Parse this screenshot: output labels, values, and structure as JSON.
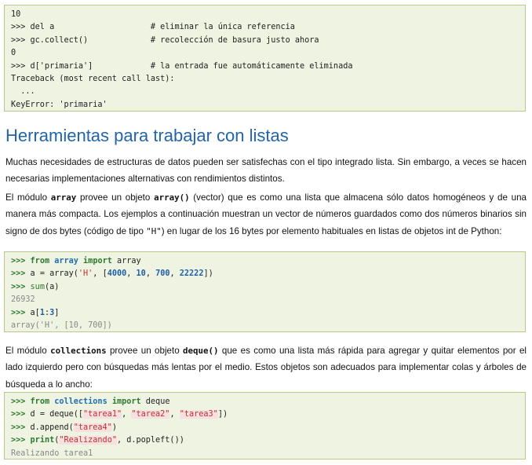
{
  "block1": [
    {
      "parts": [
        {
          "t": "10"
        }
      ]
    },
    {
      "parts": [
        {
          "t": ">>> del a                    # eliminar la única referencia"
        }
      ]
    },
    {
      "parts": [
        {
          "t": ">>> gc.collect()             # recolección de basura justo ahora"
        }
      ]
    },
    {
      "parts": [
        {
          "t": "0"
        }
      ]
    },
    {
      "parts": [
        {
          "t": ">>> d['primaria']            # la entrada fue automáticamente eliminada"
        }
      ]
    },
    {
      "parts": [
        {
          "t": "Traceback (most recent call last):"
        }
      ]
    },
    {
      "parts": [
        {
          "t": "  ..."
        }
      ]
    },
    {
      "parts": [
        {
          "t": "KeyError: 'primaria'"
        }
      ]
    }
  ],
  "heading": "Herramientas para trabajar con listas",
  "para1": "Muchas necesidades de estructuras de datos pueden ser satisfechas con el tipo integrado lista. Sin embargo, a veces se hacen necesarias implementaciones alternativas con rendimientos distintos.",
  "para2": {
    "a": "El módulo ",
    "b": "array",
    "c": " provee un objeto ",
    "d": "array()",
    "e": " (vector) que es como una lista que almacena sólo datos homogéneos y de una manera más compacta. Los ejemplos a continuación muestran un vector de números guardados como dos números binarios sin signo de dos bytes (código de tipo ",
    "f": "\"H\"",
    "g": ") en lugar de los 16 bytes por elemento habituales en listas de objetos int de Python:"
  },
  "block2": [
    {
      "parts": [
        {
          "t": ">>> ",
          "c": "pr"
        },
        {
          "t": "from",
          "c": "kw"
        },
        {
          "t": " "
        },
        {
          "t": "array",
          "c": "mod"
        },
        {
          "t": " "
        },
        {
          "t": "import",
          "c": "kw"
        },
        {
          "t": " array"
        }
      ]
    },
    {
      "parts": [
        {
          "t": ">>> ",
          "c": "pr"
        },
        {
          "t": "a = array("
        },
        {
          "t": "'H'",
          "c": "str"
        },
        {
          "t": ", ["
        },
        {
          "t": "4000",
          "c": "num"
        },
        {
          "t": ", "
        },
        {
          "t": "10",
          "c": "num"
        },
        {
          "t": ", "
        },
        {
          "t": "700",
          "c": "num"
        },
        {
          "t": ", "
        },
        {
          "t": "22222",
          "c": "num"
        },
        {
          "t": "])"
        }
      ]
    },
    {
      "parts": [
        {
          "t": ">>> ",
          "c": "pr"
        },
        {
          "t": "sum",
          "c": "bi"
        },
        {
          "t": "(a)"
        }
      ]
    },
    {
      "parts": [
        {
          "t": "26932",
          "c": "out"
        }
      ]
    },
    {
      "parts": [
        {
          "t": ">>> ",
          "c": "pr"
        },
        {
          "t": "a["
        },
        {
          "t": "1",
          "c": "num"
        },
        {
          "t": ":"
        },
        {
          "t": "3",
          "c": "num"
        },
        {
          "t": "]"
        }
      ]
    },
    {
      "parts": [
        {
          "t": "array('H', [10, 700])",
          "c": "out"
        }
      ]
    }
  ],
  "para3": {
    "a": "El módulo ",
    "b": "collections",
    "c": " provee un objeto ",
    "d": "deque()",
    "e": " que es como una lista más rápida para agregar y quitar elementos por el lado izquierdo pero con búsquedas más lentas por el medio. Estos objetos son adecuados para implementar colas y árboles de búsqueda a lo ancho:"
  },
  "block3": [
    {
      "parts": [
        {
          "t": ">>> ",
          "c": "pr"
        },
        {
          "t": "from",
          "c": "kw"
        },
        {
          "t": " "
        },
        {
          "t": "collections",
          "c": "mod"
        },
        {
          "t": " "
        },
        {
          "t": "import",
          "c": "kw"
        },
        {
          "t": " deque"
        }
      ]
    },
    {
      "parts": [
        {
          "t": ">>> ",
          "c": "pr"
        },
        {
          "t": "d = deque(["
        },
        {
          "t": "\"tarea1\"",
          "c": "strbox"
        },
        {
          "t": ", "
        },
        {
          "t": "\"tarea2\"",
          "c": "strbox"
        },
        {
          "t": ", "
        },
        {
          "t": "\"tarea3\"",
          "c": "strbox"
        },
        {
          "t": "])"
        }
      ]
    },
    {
      "parts": [
        {
          "t": ">>> ",
          "c": "pr"
        },
        {
          "t": "d.append("
        },
        {
          "t": "\"tarea4\"",
          "c": "strbox"
        },
        {
          "t": ")"
        }
      ]
    },
    {
      "parts": [
        {
          "t": ">>> ",
          "c": "pr"
        },
        {
          "t": "print",
          "c": "kw"
        },
        {
          "t": "("
        },
        {
          "t": "\"Realizando\"",
          "c": "strbox"
        },
        {
          "t": ", d.popleft())"
        }
      ]
    },
    {
      "parts": [
        {
          "t": "Realizando tarea1",
          "c": "out"
        }
      ]
    }
  ]
}
